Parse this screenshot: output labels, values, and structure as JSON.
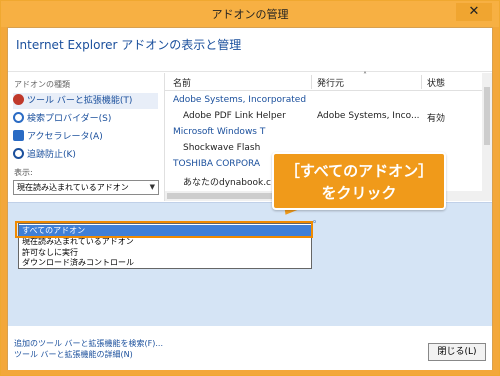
{
  "window": {
    "title": "アドオンの管理",
    "close_glyph": "✕"
  },
  "header": {
    "title": "Internet Explorer アドオンの表示と管理"
  },
  "left_pane": {
    "types_label": "アドオンの種類",
    "items": [
      {
        "label": "ツール バーと拡張機能(T)",
        "icon": "gear-icon",
        "color": "#c0392b"
      },
      {
        "label": "検索プロバイダー(S)",
        "icon": "search-icon",
        "color": "#2a6bc4"
      },
      {
        "label": "アクセラレータ(A)",
        "icon": "accelerator-icon",
        "color": "#2a6bc4"
      },
      {
        "label": "追跡防止(K)",
        "icon": "no-entry-icon",
        "color": "#1a4f9c"
      }
    ],
    "show_label": "表示:",
    "show_value": "現在読み込まれているアドオン"
  },
  "list": {
    "columns": [
      "名前",
      "発行元",
      "状態"
    ],
    "sort_caret": "˄",
    "rows": [
      {
        "kind": "group",
        "name": "Adobe Systems, Incorporated"
      },
      {
        "kind": "item",
        "name": "Adobe PDF Link Helper",
        "publisher": "Adobe Systems, Inco...",
        "status": "有効"
      },
      {
        "kind": "group",
        "name": "Microsoft Windows T"
      },
      {
        "kind": "item",
        "name": "Shockwave Flash",
        "publisher": "",
        "status": ""
      },
      {
        "kind": "group",
        "name": "TOSHIBA CORPORA"
      },
      {
        "kind": "item",
        "name": "あなたのdynabook.c",
        "publisher": "",
        "status": ""
      }
    ]
  },
  "status_fragment": "。",
  "dropdown": {
    "options": [
      "すべてのアドオン",
      "現在読み込まれているアドオン",
      "許可なしに実行",
      "ダウンロード済みコントロール"
    ]
  },
  "callout": {
    "line1": "［すべてのアドオン］",
    "line2": "をクリック"
  },
  "bottom": {
    "link_search": "追加のツール バーと拡張機能を検索(F)...",
    "link_details": "ツール バーと拡張機能の詳細(N)",
    "close_label": "閉じる(L)"
  }
}
